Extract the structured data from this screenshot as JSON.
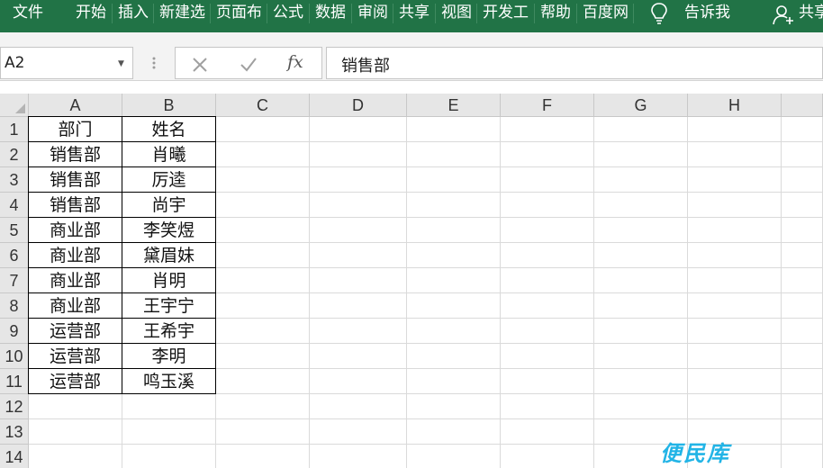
{
  "ribbon": {
    "tabs": [
      "文件",
      "开始",
      "插入",
      "新建选",
      "页面布",
      "公式",
      "数据",
      "审阅",
      "共享",
      "视图",
      "开发工",
      "帮助",
      "百度网"
    ],
    "tell_me": "告诉我",
    "share": "共享"
  },
  "formula_bar": {
    "name_box": "A2",
    "fx_label": "fx",
    "value": "销售部"
  },
  "grid": {
    "columns": [
      "A",
      "B",
      "C",
      "D",
      "E",
      "F",
      "G",
      "H"
    ],
    "rows": [
      "1",
      "2",
      "3",
      "4",
      "5",
      "6",
      "7",
      "8",
      "9",
      "10",
      "11",
      "12",
      "13",
      "14"
    ],
    "cells": [
      [
        "部门",
        "姓名"
      ],
      [
        "销售部",
        "肖曦"
      ],
      [
        "销售部",
        "厉逵"
      ],
      [
        "销售部",
        "尚宇"
      ],
      [
        "商业部",
        "李笑煜"
      ],
      [
        "商业部",
        "黛眉妹"
      ],
      [
        "商业部",
        "肖明"
      ],
      [
        "商业部",
        "王宇宁"
      ],
      [
        "运营部",
        "王希宇"
      ],
      [
        "运营部",
        "李明"
      ],
      [
        "运营部",
        "鸣玉溪"
      ]
    ]
  },
  "watermark": "便民库",
  "colors": {
    "ribbon": "#217346",
    "header": "#e6e6e6",
    "watermark": "#22b4e6"
  }
}
